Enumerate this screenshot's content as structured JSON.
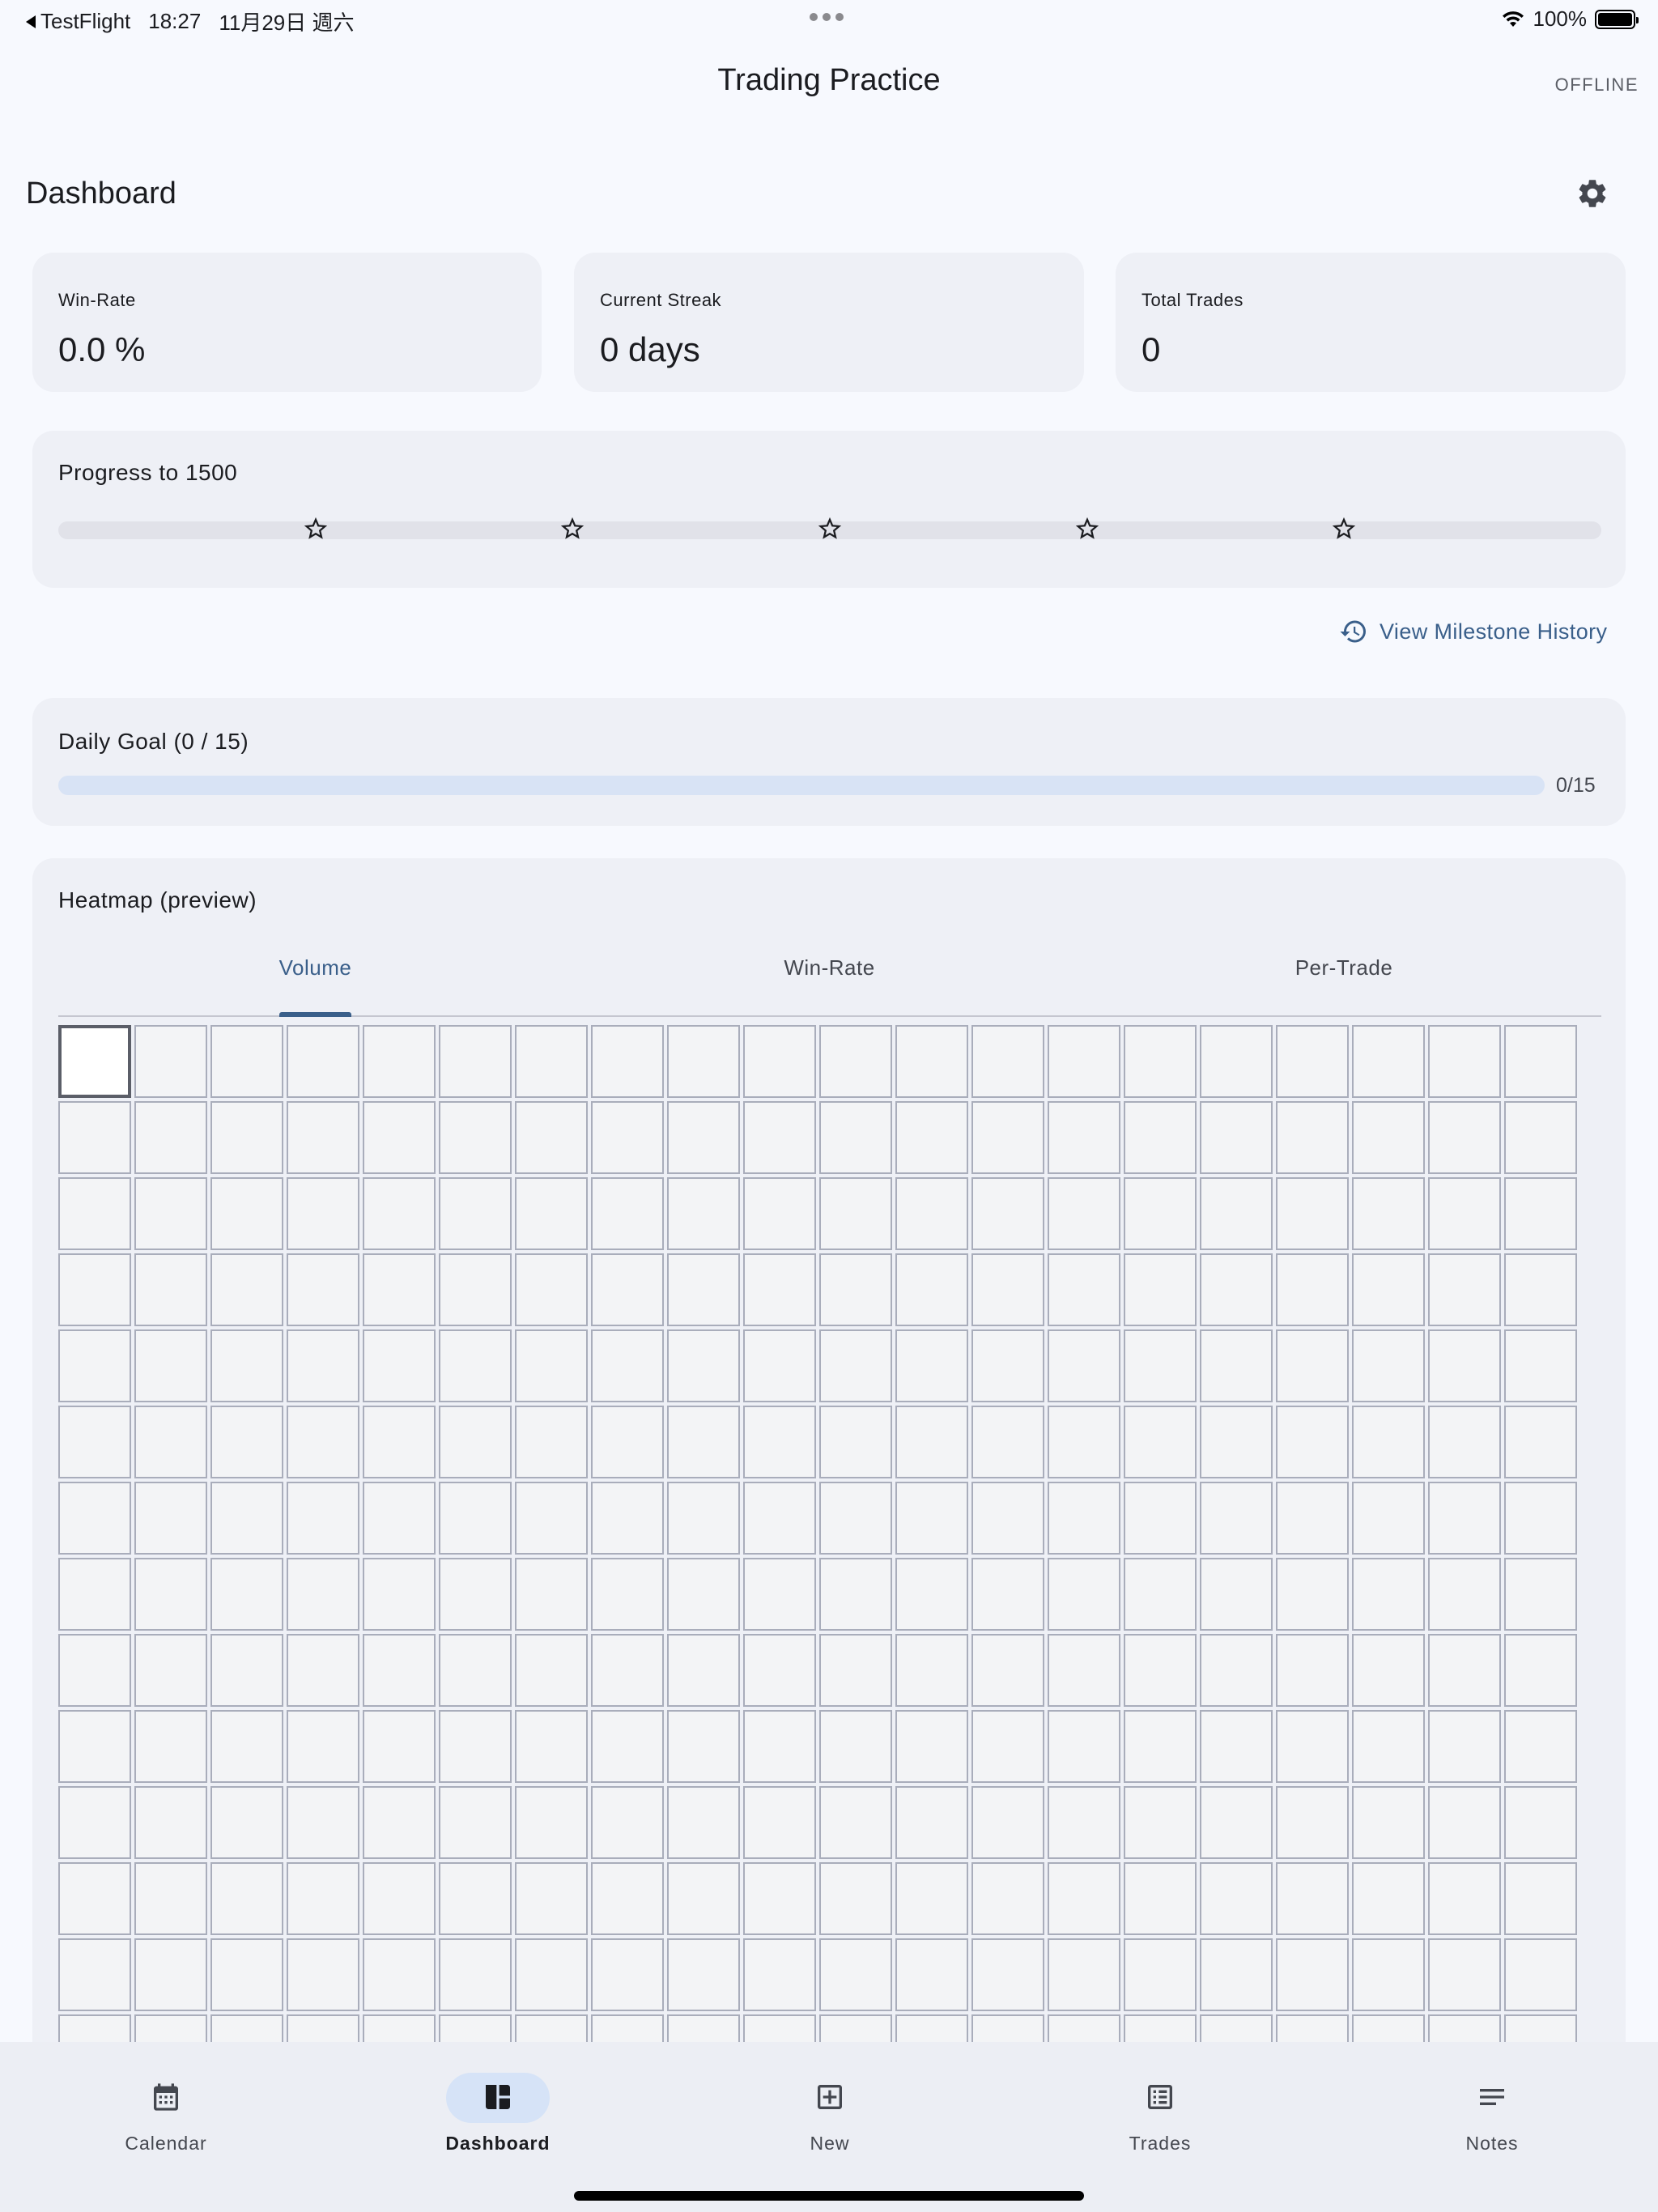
{
  "status_bar": {
    "back_app": "TestFlight",
    "time": "18:27",
    "date": "11月29日 週六",
    "battery": "100%"
  },
  "app_bar": {
    "title": "Trading Practice",
    "connection_status": "OFFLINE"
  },
  "dashboard": {
    "title": "Dashboard",
    "settings_icon": "gear-icon",
    "stats": [
      {
        "label": "Win-Rate",
        "value": "0.0 %"
      },
      {
        "label": "Current Streak",
        "value": "0 days"
      },
      {
        "label": "Total Trades",
        "value": "0"
      }
    ],
    "progress": {
      "title": "Progress to 1500",
      "value": 0,
      "milestone_count": 5,
      "milestone_icon": "star-outline-icon"
    },
    "milestone_link": {
      "label": "View Milestone History",
      "icon": "history-icon"
    },
    "daily_goal": {
      "title": "Daily Goal (0 / 15)",
      "count_label": "0/15",
      "current": 0,
      "target": 15
    },
    "heatmap": {
      "title": "Heatmap (preview)",
      "tabs": [
        "Volume",
        "Win-Rate",
        "Per-Trade"
      ],
      "active_tab": "Volume",
      "columns": 20,
      "visible_rows": 14,
      "selected_cell": [
        0,
        0
      ]
    }
  },
  "bottom_nav": {
    "items": [
      {
        "label": "Calendar",
        "icon": "calendar-icon",
        "active": false
      },
      {
        "label": "Dashboard",
        "icon": "dashboard-icon",
        "active": true
      },
      {
        "label": "New",
        "icon": "add-box-icon",
        "active": false
      },
      {
        "label": "Trades",
        "icon": "list-icon",
        "active": false
      },
      {
        "label": "Notes",
        "icon": "notes-icon",
        "active": false
      }
    ]
  },
  "colors": {
    "background": "#f7f9fe",
    "card": "#eef0f6",
    "accent": "#3a5f8a",
    "nav_active_pill": "#d6e3f7",
    "goal_track": "#d8e3f5"
  }
}
